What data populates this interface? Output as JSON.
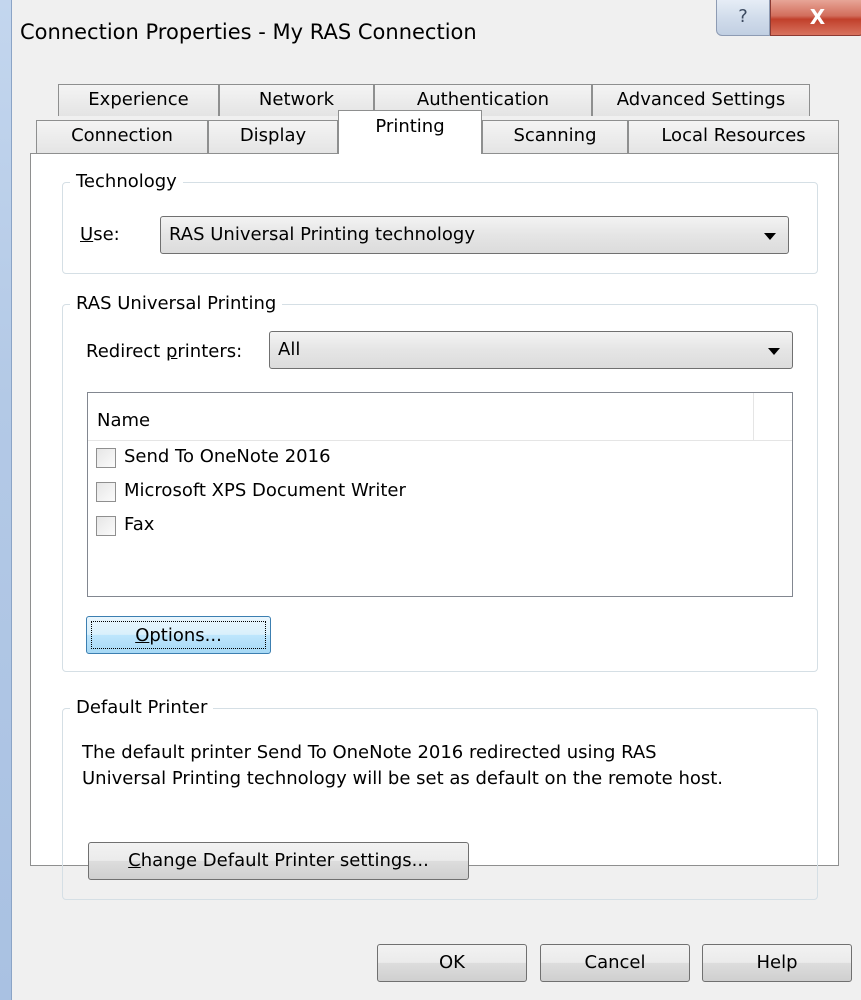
{
  "window": {
    "title": "Connection Properties - My RAS Connection",
    "help_glyph": "?",
    "close_glyph": "X"
  },
  "tabs": {
    "row_back": [
      "Experience",
      "Network",
      "Authentication",
      "Advanced Settings"
    ],
    "row_front": [
      "Connection",
      "Display",
      "Printing",
      "Scanning",
      "Local Resources"
    ],
    "active": "Printing"
  },
  "technology": {
    "legend": "Technology",
    "use_label_u": "U",
    "use_label_rest": "se:",
    "use_value": "RAS Universal Printing technology"
  },
  "universal": {
    "legend": "RAS Universal Printing",
    "redirect_label_pre": "Redirect ",
    "redirect_label_u": "p",
    "redirect_label_post": "rinters:",
    "redirect_value": "All",
    "column_name": "Name",
    "printers": [
      {
        "name": "Send To OneNote 2016",
        "checked": false
      },
      {
        "name": "Microsoft XPS Document Writer",
        "checked": false
      },
      {
        "name": "Fax",
        "checked": false
      }
    ],
    "options_u": "O",
    "options_rest": "ptions..."
  },
  "default_printer": {
    "legend": "Default Printer",
    "line1": "The default printer Send To OneNote 2016 redirected using RAS",
    "line2": "Universal Printing technology will be set as default on the remote host.",
    "change_u": "C",
    "change_rest": "hange Default Printer settings..."
  },
  "footer": {
    "ok": "OK",
    "cancel": "Cancel",
    "help": "Help"
  }
}
